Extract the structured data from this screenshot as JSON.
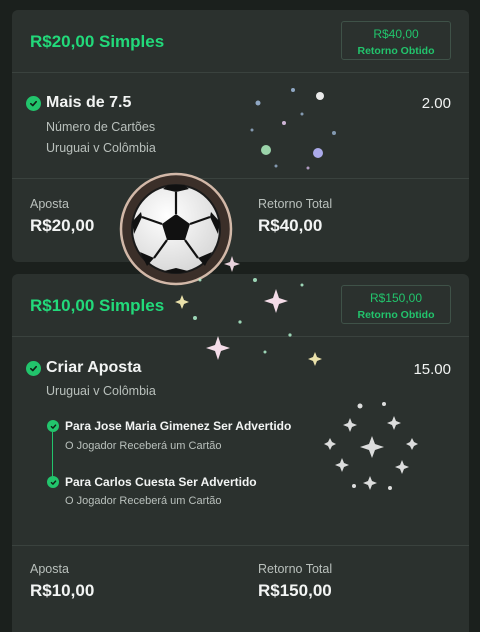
{
  "bet1": {
    "title": "R$20,00 Simples",
    "return_amount": "R$40,00",
    "return_label": "Retorno Obtido",
    "selection": {
      "title": "Mais de 7.5",
      "odds": "2.00",
      "market": "Número de Cartões",
      "match": "Uruguai v Colômbia"
    },
    "stake_label": "Aposta",
    "stake_value": "R$20,00",
    "total_label": "Retorno Total",
    "total_value": "R$40,00"
  },
  "bet2": {
    "title": "R$10,00 Simples",
    "return_amount": "R$150,00",
    "return_label": "Retorno Obtido",
    "selection": {
      "title": "Criar Aposta",
      "odds": "15.00",
      "match": "Uruguai v Colômbia"
    },
    "legs": [
      {
        "title": "Para Jose Maria Gimenez Ser Advertido",
        "sub": "O Jogador Receberá um Cartão"
      },
      {
        "title": "Para Carlos Cuesta Ser Advertido",
        "sub": "O Jogador Receberá um Cartão"
      }
    ],
    "stake_label": "Aposta",
    "stake_value": "R$10,00",
    "total_label": "Retorno Total",
    "total_value": "R$150,00"
  },
  "colors": {
    "accent": "#22d97a",
    "background": "#1b201d",
    "card": "#2b312e"
  },
  "icons": [
    "check-circle-icon",
    "soccer-ball-icon",
    "sparkle-icon"
  ]
}
